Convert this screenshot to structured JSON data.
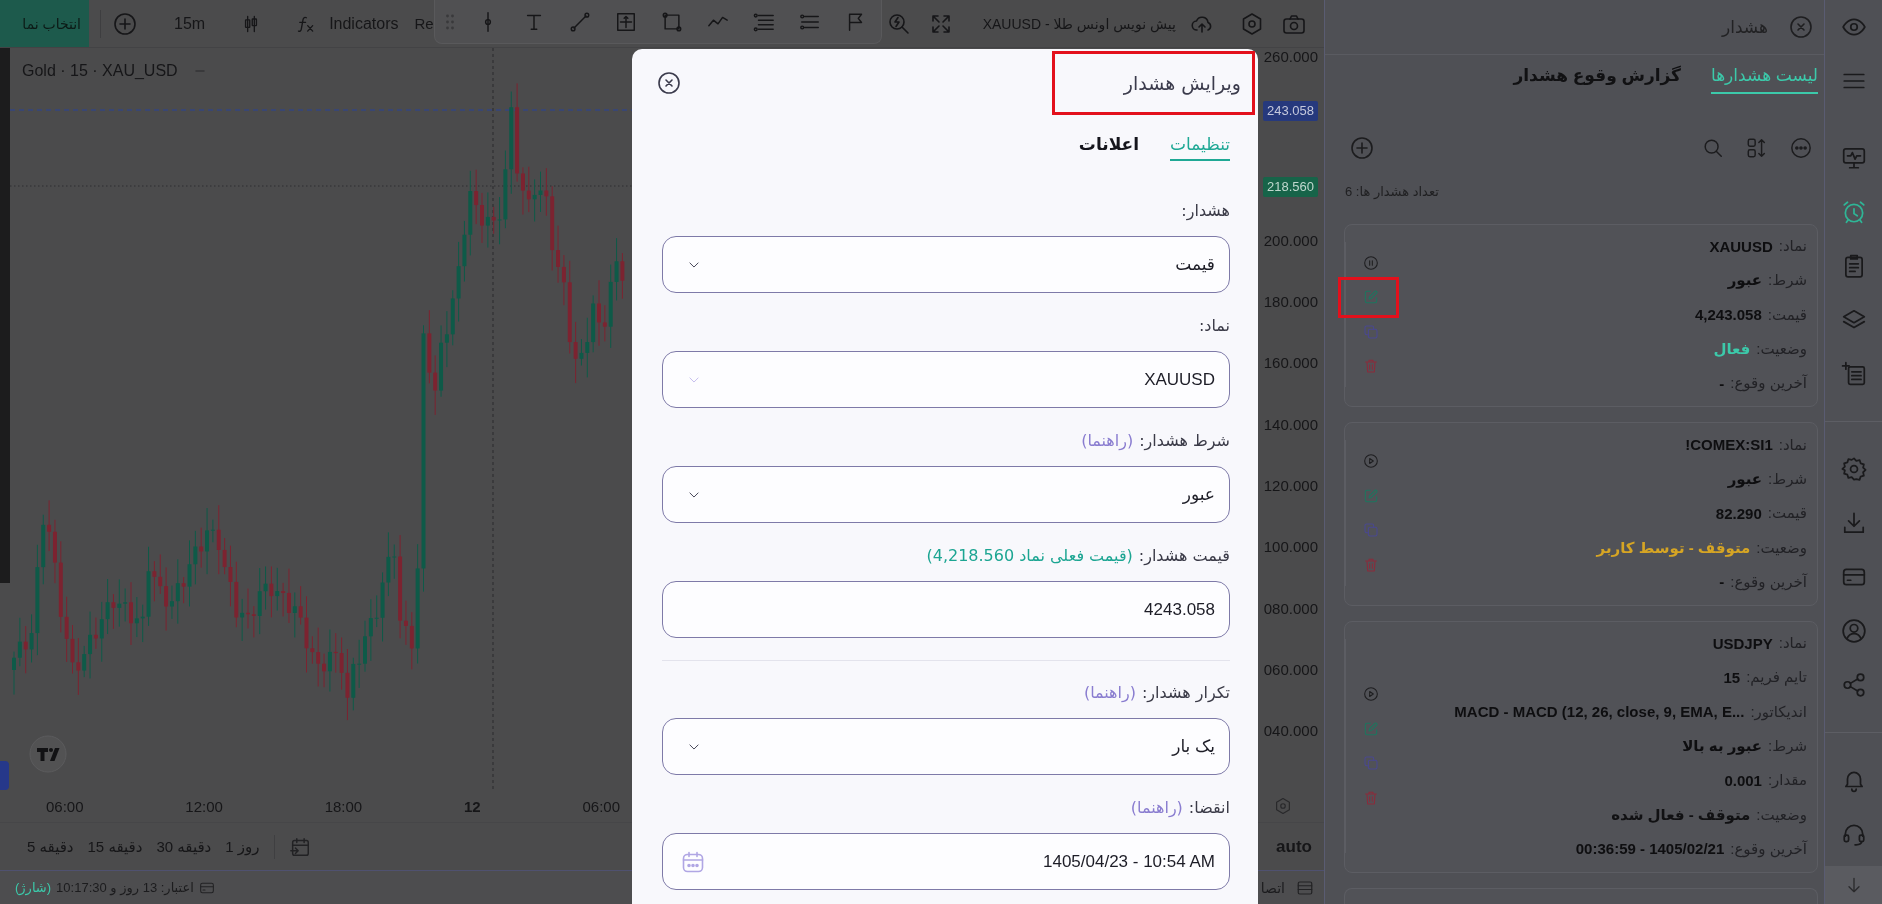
{
  "toolbar": {
    "symbol_button": "انتخاب نما",
    "interval": "15m",
    "indicators": "Indicators",
    "replay": "Re",
    "chart_title": "XAUUSD - پیش نویس اونس طلا"
  },
  "chart": {
    "legend": "Gold · 15 · XAU_USD",
    "price_axis": {
      "labels": [
        "260.000",
        "200.000",
        "180.000",
        "160.000",
        "140.000",
        "120.000",
        "100.000",
        "080.000",
        "060.000",
        "040.000"
      ],
      "tags": [
        {
          "text": "243.058",
          "kind": "alert"
        },
        {
          "text": "218.560",
          "kind": "current"
        }
      ]
    },
    "time_axis": [
      {
        "text": "06:00",
        "bold": false
      },
      {
        "text": "12",
        "bold": true
      },
      {
        "text": "18:00",
        "bold": false
      },
      {
        "text": "12:00",
        "bold": false
      },
      {
        "text": "06:00",
        "bold": false
      }
    ],
    "scale_mode": "auto"
  },
  "timeframes": [
    {
      "label": "1 روز"
    },
    {
      "label": "30 دقیقه"
    },
    {
      "label": "15 دقیقه"
    },
    {
      "label": "5 دقیقه"
    }
  ],
  "status_bar": {
    "recharge": "(شارژ)",
    "credit": "اعتبار: 13 روز و 10:17:30",
    "connection": "اتصا"
  },
  "alert_dialog": {
    "title": "ویرایش هشدار",
    "title_highlighted": true,
    "tabs": [
      {
        "label": "تنظیمات",
        "selected": true
      },
      {
        "label": "اعلانات",
        "selected": false
      }
    ],
    "fields": [
      {
        "kind": "select",
        "label": "هشدار:",
        "value": "قیمت",
        "disabled": false,
        "divider_before": false
      },
      {
        "kind": "select",
        "label": "نماد:",
        "value": "XAUUSD",
        "disabled": true,
        "divider_before": false
      },
      {
        "kind": "select",
        "label": "شرط هشدار:",
        "hint": {
          "text": "(راهنما)",
          "kind": "help"
        },
        "value": "عبور",
        "disabled": false,
        "divider_before": false
      },
      {
        "kind": "input",
        "label": "قیمت هشدار:",
        "hint": {
          "text": "(قیمت فعلی نماد 4,218.560)",
          "kind": "price"
        },
        "value": "4243.058",
        "disabled": false,
        "divider_before": false
      },
      {
        "kind": "select",
        "label": "تکرار هشدار:",
        "hint": {
          "text": "(راهنما)",
          "kind": "help"
        },
        "value": "یک بار",
        "disabled": false,
        "divider_before": true
      },
      {
        "kind": "date",
        "label": "انقضا:",
        "hint": {
          "text": "(راهنما)",
          "kind": "help"
        },
        "value": "1405/04/23 - 10:54 AM",
        "disabled": false,
        "divider_before": false
      }
    ]
  },
  "alerts_panel": {
    "title": "هشدار",
    "tabs": [
      {
        "label": "لیست هشدارها",
        "selected": true
      },
      {
        "label": "گزارش وقوع هشدار",
        "selected": false
      }
    ],
    "count": "تعداد هشدار ها: 6",
    "alerts": [
      {
        "running": true,
        "edit_highlighted": true,
        "fields": [
          {
            "label": "نماد:",
            "value": "XAUUSD"
          },
          {
            "label": "شرط:",
            "value": "عبور"
          },
          {
            "label": "قیمت:",
            "value": "4,243.058"
          },
          {
            "label": "وضعیت:",
            "value": "فعال",
            "color": "#3cc9aa"
          },
          {
            "label": "آخرین وقوع:",
            "value": "-"
          }
        ]
      },
      {
        "running": false,
        "edit_highlighted": false,
        "fields": [
          {
            "label": "نماد:",
            "value": "!COMEX:SI1"
          },
          {
            "label": "شرط:",
            "value": "عبور"
          },
          {
            "label": "قیمت:",
            "value": "82.290"
          },
          {
            "label": "وضعیت:",
            "value": "متوقف - توسط کاربر",
            "color": "#d6a524"
          },
          {
            "label": "آخرین وقوع:",
            "value": "-"
          }
        ]
      },
      {
        "running": false,
        "edit_highlighted": false,
        "fields": [
          {
            "label": "نماد:",
            "value": "USDJPY"
          },
          {
            "label": "تایم فریم:",
            "value": "15"
          },
          {
            "label": "اندیکاتور:",
            "value": "MACD - MACD (12, 26, close, 9, EMA, E..."
          },
          {
            "label": "شرط:",
            "value": "عبور به بالا"
          },
          {
            "label": "مقدار:",
            "value": "0.001"
          },
          {
            "label": "وضعیت:",
            "value": "متوقف - فعال شده",
            "color": "#111113"
          },
          {
            "label": "آخرین وقوع:",
            "value": "00:36:59 - 1405/02/21"
          }
        ]
      }
    ]
  },
  "sidebar": {
    "groups": [
      {
        "divider": false,
        "items": [
          {
            "kind": "eye",
            "selected": false
          },
          {
            "kind": "menu",
            "selected": false
          }
        ]
      },
      {
        "divider": false,
        "items": [
          {
            "kind": "monitor",
            "selected": false
          },
          {
            "kind": "alarm",
            "selected": true
          },
          {
            "kind": "clipboard",
            "selected": false
          },
          {
            "kind": "layers",
            "selected": false
          },
          {
            "kind": "listadd",
            "selected": false
          }
        ]
      },
      {
        "divider": true,
        "items": [
          {
            "kind": "gear",
            "selected": false
          },
          {
            "kind": "download",
            "selected": false
          },
          {
            "kind": "card",
            "selected": false
          },
          {
            "kind": "user",
            "selected": false
          },
          {
            "kind": "share",
            "selected": false
          }
        ]
      },
      {
        "divider": true,
        "items": [
          {
            "kind": "bell",
            "selected": false
          },
          {
            "kind": "headset",
            "selected": false
          }
        ]
      }
    ]
  }
}
